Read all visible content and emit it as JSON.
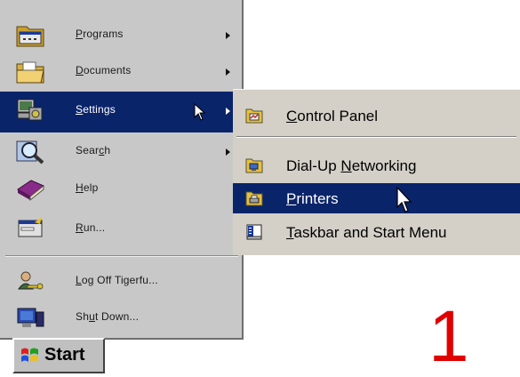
{
  "start_menu": {
    "items": [
      {
        "key": "P",
        "rest": "rograms",
        "has_submenu": true
      },
      {
        "key": "D",
        "rest": "ocuments",
        "has_submenu": true
      },
      {
        "key": "S",
        "rest": "ettings",
        "has_submenu": true,
        "selected": true
      },
      {
        "pre": "Sear",
        "key": "c",
        "rest": "h",
        "has_submenu": true
      },
      {
        "key": "H",
        "rest": "elp",
        "has_submenu": false
      },
      {
        "key": "R",
        "rest": "un...",
        "has_submenu": false
      },
      {
        "key": "L",
        "rest": "og Off Tigerfu...",
        "has_submenu": false
      },
      {
        "pre": "Sh",
        "key": "u",
        "rest": "t Down...",
        "has_submenu": false
      }
    ]
  },
  "settings_submenu": {
    "items": [
      {
        "key": "C",
        "rest": "ontrol Panel"
      },
      {
        "pre": "Dial-Up ",
        "key": "N",
        "rest": "etworking"
      },
      {
        "key": "P",
        "rest": "rinters",
        "selected": true
      },
      {
        "key": "T",
        "rest": "askbar and Start Menu"
      }
    ]
  },
  "taskbar": {
    "start_label": "Start"
  },
  "step_number": "1",
  "colors": {
    "highlight": "#0a246a",
    "menu_bg": "#c8c8c8",
    "step_number": "#e00000"
  },
  "icons": [
    "programs-folder-icon",
    "documents-folder-icon",
    "settings-icon",
    "search-icon",
    "help-book-icon",
    "run-icon",
    "log-off-icon",
    "shut-down-icon",
    "control-panel-icon",
    "dial-up-networking-icon",
    "printers-icon",
    "taskbar-icon",
    "windows-logo-icon",
    "arrow-cursor-icon"
  ]
}
